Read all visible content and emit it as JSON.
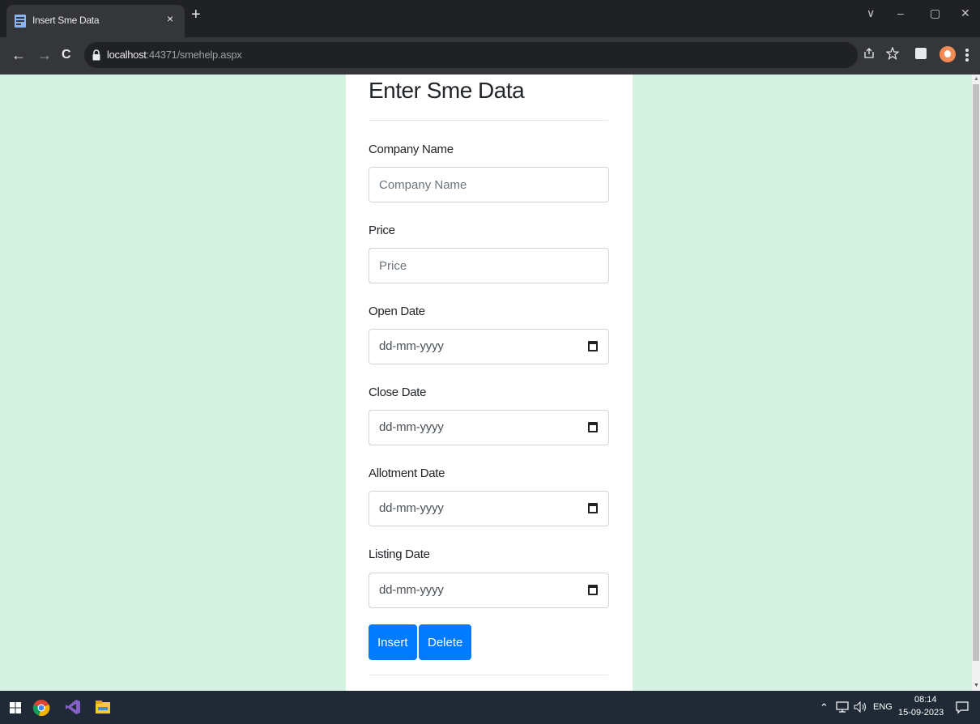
{
  "browser": {
    "tab_title": "Insert Sme Data",
    "tab_close": "×",
    "new_tab": "+",
    "url_host": "localhost",
    "url_path": ":44371/smehelp.aspx",
    "window_controls": [
      "∨",
      "–",
      "▢",
      "✕"
    ],
    "nav": [
      "←",
      "→",
      "C"
    ]
  },
  "form": {
    "title": "Enter Sme Data",
    "fields": [
      {
        "label": "Company Name",
        "placeholder": "Company Name",
        "type": "text"
      },
      {
        "label": "Price",
        "placeholder": "Price",
        "type": "text"
      },
      {
        "label": "Open Date",
        "value": "dd-mm-yyyy",
        "type": "date"
      },
      {
        "label": "Close Date",
        "value": "dd-mm-yyyy",
        "type": "date"
      },
      {
        "label": "Allotment Date",
        "value": "dd-mm-yyyy",
        "type": "date"
      },
      {
        "label": "Listing Date",
        "value": "dd-mm-yyyy",
        "type": "date"
      }
    ],
    "buttons": {
      "insert": "Insert",
      "delete": "Delete"
    }
  },
  "taskbar": {
    "language": "ENG",
    "time": "08:14",
    "date": "15-09-2023",
    "icons": [
      "windows-start-icon",
      "chrome-icon",
      "visual-studio-icon",
      "file-explorer-icon"
    ]
  },
  "colors": {
    "page_background": "#d5f1e2",
    "button_primary": "#007bff",
    "card_background": "#ffffff"
  }
}
